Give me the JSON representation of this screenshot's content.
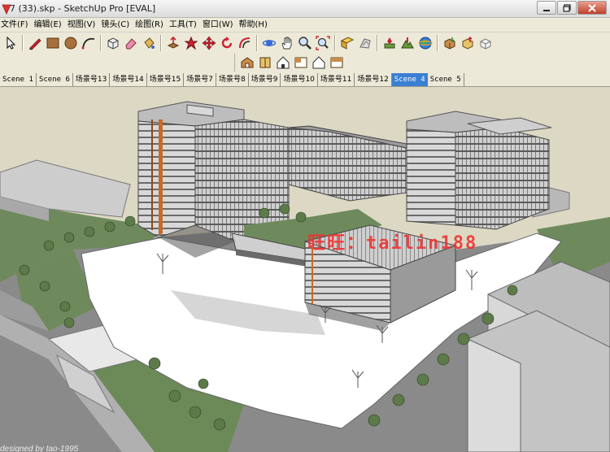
{
  "window": {
    "title": "7 (33).skp - SketchUp Pro [EVAL]"
  },
  "menu": [
    "文件(F)",
    "编辑(E)",
    "视图(V)",
    "镜头(C)",
    "绘图(R)",
    "工具(T)",
    "窗口(W)",
    "帮助(H)"
  ],
  "toolbar1": {
    "tools": [
      "select-arrow-icon",
      "pencil-line-icon",
      "rectangle-icon",
      "circle-icon",
      "arc-icon",
      "make-component-icon",
      "eraser-icon",
      "paint-bucket-icon",
      "push-pull-icon",
      "follow-me-icon",
      "move-icon",
      "rotate-icon",
      "offset-icon",
      "orbit-icon",
      "pan-hand-icon",
      "zoom-icon",
      "zoom-extents-icon",
      "section-plane-icon",
      "walk-icon",
      "add-location-icon",
      "toggle-terrain-icon",
      "google-earth-icon",
      "get-models-icon",
      "share-model-icon",
      "component-share-icon"
    ]
  },
  "toolbar2": {
    "views": [
      "iso-view-icon",
      "top-view-icon",
      "front-view-icon",
      "right-view-icon",
      "back-view-icon",
      "left-view-icon"
    ]
  },
  "scene_tabs": [
    {
      "label": "Scene 1",
      "active": false
    },
    {
      "label": "Scene 6",
      "active": false
    },
    {
      "label": "场景号13",
      "active": false
    },
    {
      "label": "场景号14",
      "active": false
    },
    {
      "label": "场景号15",
      "active": false
    },
    {
      "label": "场景号7",
      "active": false
    },
    {
      "label": "场景号8",
      "active": false
    },
    {
      "label": "场景号9",
      "active": false
    },
    {
      "label": "场景号10",
      "active": false
    },
    {
      "label": "场景号11",
      "active": false
    },
    {
      "label": "场景号12",
      "active": false
    },
    {
      "label": "Scene 4",
      "active": true
    },
    {
      "label": "Scene 5",
      "active": false
    }
  ],
  "viewport": {
    "watermark": "旺旺：tailin188",
    "credit": "designed by tao-1995"
  },
  "colors": {
    "accent_tab": "#3a7fd4",
    "watermark": "#ee3333",
    "sky": "#dcd8c4",
    "road": "#8a8a8a",
    "plaza": "#ffffff",
    "lawn": "#6e8a5c"
  }
}
